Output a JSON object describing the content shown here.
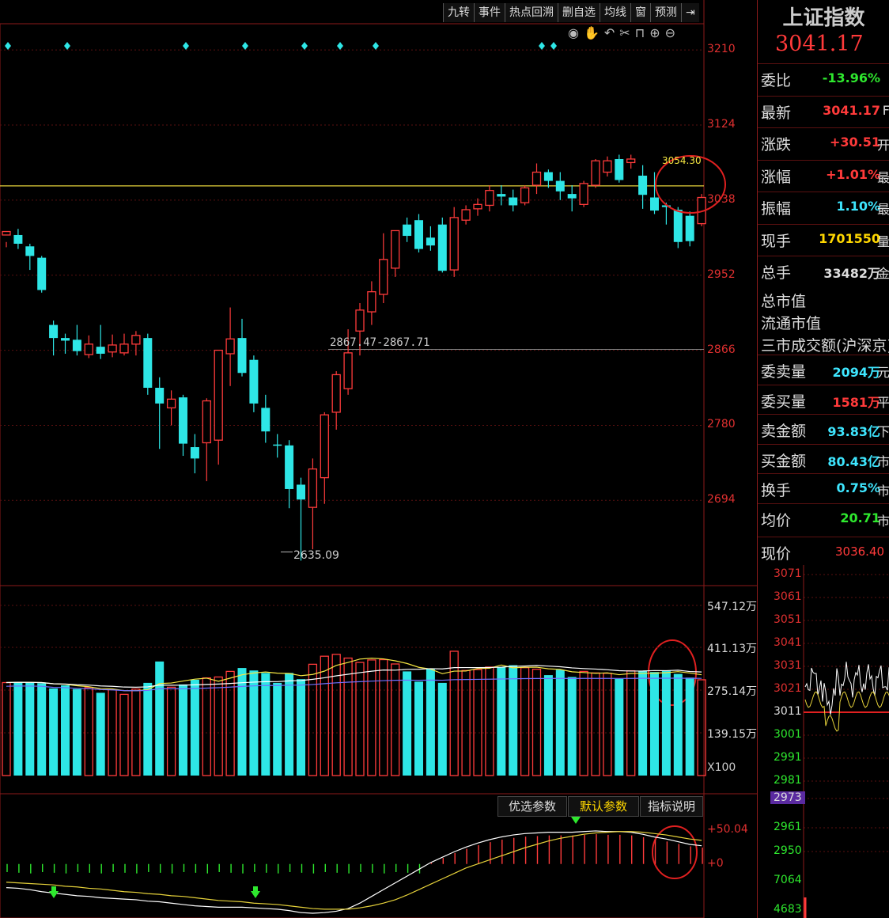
{
  "toolbar": [
    "九转",
    "事件",
    "热点回溯",
    "删自选",
    "均线",
    "窗",
    "预测",
    "⇥"
  ],
  "tool_icons": [
    "eye-icon",
    "hand-icon",
    "undo-icon",
    "scissors-icon",
    "lock-icon",
    "zoom-in-icon",
    "zoom-out-icon"
  ],
  "tool_icon_glyphs": [
    "◉",
    "✋",
    "↶",
    "✂",
    "⊓",
    "⊕",
    "⊖"
  ],
  "price_axis": [
    "3210",
    "3124",
    "3038",
    "2952",
    "2866",
    "2780",
    "2694"
  ],
  "annotations": {
    "h_line_label": "3054.30",
    "low_label": "2635.09",
    "range_label": "2867.47-2867.71"
  },
  "volume_axis": [
    "547.12万",
    "411.13万",
    "275.14万",
    "139.15万"
  ],
  "volume_unit": "X100",
  "macd_axis": [
    "+50.04",
    "+0"
  ],
  "macd_buttons": [
    "优选参数",
    "默认参数",
    "指标说明"
  ],
  "quote": {
    "title": "上证指数",
    "price": "3041.17",
    "rows": [
      {
        "k": "委比",
        "v": "-13.96%",
        "color": "#2ee82e",
        "x": ""
      },
      {
        "k": "最新",
        "v": "3041.17",
        "color": "#ff3a3a",
        "x": "F"
      },
      {
        "k": "涨跌",
        "v": "+30.51",
        "color": "#ff3a3a",
        "x": "开"
      },
      {
        "k": "涨幅",
        "v": "+1.01%",
        "color": "#ff3a3a",
        "x": "最"
      },
      {
        "k": "振幅",
        "v": "1.10%",
        "color": "#3ee6ff",
        "x": "最"
      },
      {
        "k": "现手",
        "v": "1701550",
        "color": "#ffd700",
        "x": "量"
      },
      {
        "k": "总手",
        "v": "33482万",
        "color": "#dddddd",
        "x": "金"
      }
    ],
    "mid_rows": [
      "总市值",
      "流通市值",
      "三市成交额(沪深京)"
    ],
    "rows2": [
      {
        "k": "委卖量",
        "v": "2094万",
        "color": "#3ee6ff",
        "x": "元"
      },
      {
        "k": "委买量",
        "v": "1581万",
        "color": "#ff3a3a",
        "x": "平"
      },
      {
        "k": "卖金额",
        "v": "93.83亿",
        "color": "#3ee6ff",
        "x": "下"
      },
      {
        "k": "买金额",
        "v": "80.43亿",
        "color": "#3ee6ff",
        "x": "市"
      },
      {
        "k": "换手",
        "v": "0.75%",
        "color": "#3ee6ff",
        "x": "市"
      },
      {
        "k": "均价",
        "v": "20.71",
        "color": "#2ee82e",
        "x": "市"
      }
    ],
    "now_label": "现价",
    "now_value": "3036.40",
    "mini_axis": [
      "3071",
      "3061",
      "3051",
      "3041",
      "3031",
      "3021",
      "3011",
      "3001",
      "2991",
      "2981",
      "2973",
      "2961",
      "2950",
      "7064",
      "4683"
    ]
  },
  "colors": {
    "up": "#ff3b3b",
    "down": "#2ee6e6",
    "ma5": "#ffffff",
    "ma10": "#f5e642",
    "ma20": "#7070ff"
  },
  "chart_data": {
    "type": "candlestick",
    "title": "上证指数",
    "ylim": [
      2600,
      3240
    ],
    "candles": [
      [
        2998,
        3002,
        2990,
        2984
      ],
      [
        2998,
        2988,
        3005,
        2982
      ],
      [
        2985,
        2974,
        2988,
        2958
      ],
      [
        2972,
        2935,
        2974,
        2932
      ],
      [
        2895,
        2880,
        2900,
        2860
      ],
      [
        2880,
        2877,
        2885,
        2862
      ],
      [
        2878,
        2865,
        2895,
        2860
      ],
      [
        2861,
        2873,
        2883,
        2857
      ],
      [
        2870,
        2862,
        2895,
        2856
      ],
      [
        2864,
        2872,
        2884,
        2858
      ],
      [
        2863,
        2873,
        2885,
        2860
      ],
      [
        2873,
        2883,
        2888,
        2860
      ],
      [
        2880,
        2823,
        2885,
        2815
      ],
      [
        2823,
        2805,
        2835,
        2753
      ],
      [
        2800,
        2810,
        2820,
        2780
      ],
      [
        2812,
        2759,
        2815,
        2745
      ],
      [
        2755,
        2742,
        2770,
        2725
      ],
      [
        2760,
        2808,
        2811,
        2716
      ],
      [
        2763,
        2866,
        2864,
        2735
      ],
      [
        2862,
        2879,
        2915,
        2825
      ],
      [
        2880,
        2840,
        2902,
        2836
      ],
      [
        2855,
        2805,
        2860,
        2795
      ],
      [
        2800,
        2773,
        2815,
        2760
      ],
      [
        2758,
        2757,
        2770,
        2743
      ],
      [
        2757,
        2707,
        2763,
        2685
      ],
      [
        2712,
        2695,
        2720,
        2625
      ],
      [
        2686,
        2730,
        2742,
        2638
      ],
      [
        2720,
        2792,
        2795,
        2690
      ],
      [
        2795,
        2838,
        2842,
        2775
      ],
      [
        2822,
        2863,
        2890,
        2815
      ],
      [
        2888,
        2912,
        2920,
        2860
      ],
      [
        2910,
        2933,
        2945,
        2895
      ],
      [
        2930,
        2970,
        3000,
        2920
      ],
      [
        2960,
        3003,
        3003,
        2950
      ],
      [
        3010,
        2997,
        3018,
        2990
      ],
      [
        3015,
        2982,
        3022,
        2978
      ],
      [
        2995,
        2986,
        3008,
        2980
      ],
      [
        3010,
        2957,
        3018,
        2955
      ],
      [
        2958,
        3018,
        3030,
        2950
      ],
      [
        3015,
        3027,
        3032,
        3010
      ],
      [
        3028,
        3033,
        3040,
        3020
      ],
      [
        3032,
        3049,
        3055,
        3025
      ],
      [
        3045,
        3042,
        3055,
        3032
      ],
      [
        3041,
        3032,
        3050,
        3025
      ],
      [
        3035,
        3052,
        3055,
        3032
      ],
      [
        3055,
        3070,
        3080,
        3045
      ],
      [
        3070,
        3060,
        3073,
        3052
      ],
      [
        3060,
        3048,
        3070,
        3038
      ],
      [
        3045,
        3040,
        3055,
        3025
      ],
      [
        3033,
        3057,
        3060,
        3030
      ],
      [
        3055,
        3083,
        3085,
        3052
      ],
      [
        3070,
        3083,
        3088,
        3065
      ],
      [
        3085,
        3061,
        3090,
        3058
      ],
      [
        3081,
        3085,
        3090,
        3074
      ],
      [
        3066,
        3044,
        3078,
        3028
      ],
      [
        3041,
        3026,
        3070,
        3022
      ],
      [
        3032,
        3030,
        3035,
        3010
      ],
      [
        3027,
        2990,
        3030,
        2983
      ],
      [
        3020,
        2991,
        3025,
        2985
      ],
      [
        3011,
        3041,
        3045,
        3008
      ]
    ],
    "volume": [
      300,
      302,
      300,
      298,
      281,
      291,
      279,
      284,
      267,
      277,
      262,
      279,
      299,
      368,
      285,
      294,
      309,
      315,
      318,
      336,
      347,
      339,
      331,
      299,
      331,
      311,
      359,
      385,
      391,
      379,
      365,
      373,
      374,
      360,
      336,
      303,
      345,
      299,
      401,
      339,
      342,
      350,
      351,
      356,
      348,
      343,
      324,
      341,
      318,
      336,
      331,
      330,
      312,
      338,
      338,
      334,
      338,
      328,
      316,
      309
    ],
    "volume_ylim": [
      0,
      600
    ],
    "macd": {
      "dif": [
        -35,
        -36,
        -38,
        -41,
        -43,
        -45,
        -47,
        -48,
        -50,
        -51,
        -52,
        -53,
        -55,
        -56,
        -58,
        -60,
        -62,
        -63,
        -64,
        -64,
        -64,
        -65,
        -66,
        -67,
        -69,
        -72,
        -73,
        -72,
        -70,
        -66,
        -58,
        -48,
        -38,
        -28,
        -18,
        -8,
        2,
        10,
        18,
        25,
        31,
        36,
        40,
        43,
        45,
        46,
        47,
        47,
        47,
        48,
        49,
        48,
        48,
        47,
        44,
        40,
        37,
        33,
        29,
        27
      ],
      "dea": [
        -27,
        -28,
        -29,
        -30,
        -31,
        -33,
        -34,
        -36,
        -37,
        -39,
        -41,
        -42,
        -44,
        -45,
        -47,
        -48,
        -50,
        -52,
        -54,
        -55,
        -56,
        -58,
        -59,
        -60,
        -62,
        -64,
        -66,
        -67,
        -67,
        -67,
        -65,
        -62,
        -58,
        -53,
        -46,
        -38,
        -30,
        -22,
        -14,
        -6,
        0,
        6,
        12,
        18,
        24,
        29,
        34,
        38,
        41,
        44,
        46,
        47,
        48,
        48,
        47,
        45,
        43,
        40,
        37,
        35
      ],
      "ylim": [
        -80,
        70
      ]
    }
  }
}
